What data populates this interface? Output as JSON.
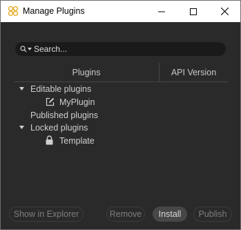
{
  "window": {
    "title": "Manage Plugins",
    "accent_color": "#e8b53d"
  },
  "search": {
    "placeholder": "Search...",
    "value": ""
  },
  "table": {
    "columns": [
      "Plugins",
      "API Version"
    ]
  },
  "tree": {
    "groups": [
      {
        "label": "Editable plugins",
        "expanded": true,
        "items": [
          {
            "label": "MyPlugin",
            "icon": "edit-icon"
          }
        ]
      },
      {
        "label": "Published plugins",
        "expanded": false,
        "items": []
      },
      {
        "label": "Locked plugins",
        "expanded": true,
        "items": [
          {
            "label": "Template",
            "icon": "lock-icon"
          }
        ]
      }
    ]
  },
  "buttons": {
    "show_in_explorer": "Show in Explorer",
    "remove": "Remove",
    "install": "Install",
    "publish": "Publish"
  }
}
